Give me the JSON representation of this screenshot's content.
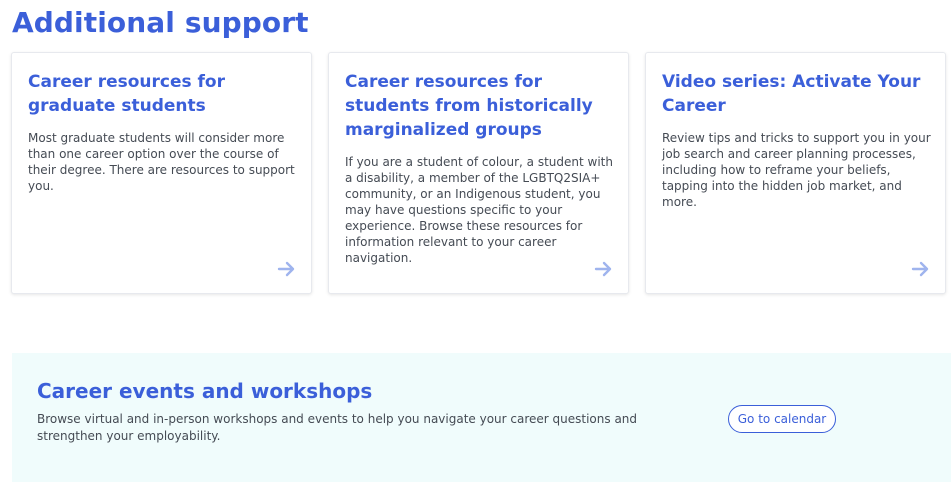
{
  "section": {
    "title": "Additional support"
  },
  "cards": [
    {
      "title": "Career resources for graduate students",
      "description": "Most graduate students will consider more than one career option over the course of their degree. There are resources to support you.",
      "arrow_icon": "arrow-right-icon"
    },
    {
      "title": "Career resources for students from historically marginalized groups",
      "description": "If you are a student of colour, a student with a disability, a member of the LGBTQ2SIA+ community, or an Indigenous student, you may have questions specific to your experience. Browse these resources for information relevant to your career navigation.",
      "arrow_icon": "arrow-right-icon"
    },
    {
      "title": "Video series: Activate Your Career",
      "description": "Review tips and tricks to support you in your job search and career planning processes, including how to reframe your beliefs, tapping into the hidden job market, and more.",
      "arrow_icon": "arrow-right-icon"
    }
  ],
  "events": {
    "title": "Career events and workshops",
    "description": "Browse virtual and in-person workshops and events to help you navigate your career questions and strengthen your employability.",
    "button_label": "Go to calendar"
  },
  "colors": {
    "accent": "#3b5fd9",
    "arrow": "#9fb4ee",
    "body_text": "#454b54",
    "events_background": "#f0fcfc",
    "card_border": "#e7e9ee"
  }
}
